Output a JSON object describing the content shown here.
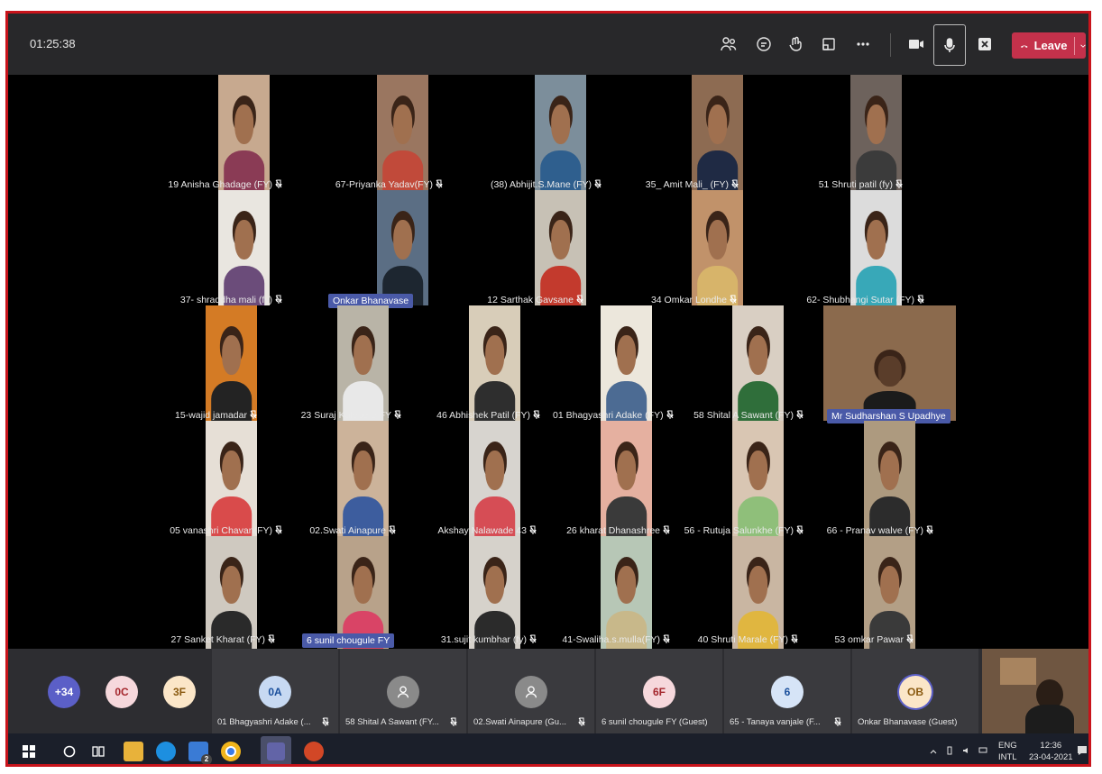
{
  "meeting": {
    "timer": "01:25:38",
    "leave_label": "Leave",
    "accent": "#c4314b",
    "frame_color": "#c8141b"
  },
  "toolbar_icons": [
    "people-icon",
    "chat-icon",
    "reactions-icon",
    "share-tray-icon",
    "more-options-icon",
    "camera-icon",
    "microphone-icon",
    "share-screen-icon"
  ],
  "grid": {
    "row1": [
      {
        "name": "19 Anisha Ghadage (FY)",
        "bg": "#c7a98f"
      },
      {
        "name": "67-Priyanka Yadav(FY)",
        "bg": "#9a7660"
      },
      {
        "name": "(38) Abhijit.S.Mane (FY)",
        "bg": "#7c8e9b"
      },
      {
        "name": "35_ Amit  Mali_ (FY)",
        "bg": "#8d6b52"
      },
      {
        "name": "51 Shruti patil (fy)",
        "bg": "#6d625c"
      }
    ],
    "row2": [
      {
        "name": "37- shraddha mali (fy)",
        "bg": "#e9e6e0"
      },
      {
        "name": "Onkar Bhanavase",
        "bg": "#5b6e84"
      },
      {
        "name": "12 Sarthak Gavsane",
        "bg": "#c7c1b5"
      },
      {
        "name": "34 Omkar Londhe",
        "bg": "#c1926a"
      },
      {
        "name": "62- Shubhangi Sutar (FY)",
        "bg": "#dcdcdc"
      }
    ],
    "row3": [
      {
        "name": "15-wajid jamadar",
        "bg": "#d47b25"
      },
      {
        "name": "23 Suraj Kalebere FY",
        "bg": "#b9b4a7"
      },
      {
        "name": "46 Abhishek Patil (FY)",
        "bg": "#d8cdb9"
      },
      {
        "name": "01 Bhagyashri Adake (FY)",
        "bg": "#ece7dc"
      },
      {
        "name": "58 Shital A Sawant (FY)",
        "bg": "#d9cfc3"
      },
      {
        "name": "Mr Sudharshan  S Upadhye",
        "bg": "#8b6a4d"
      }
    ],
    "row4": [
      {
        "name": "05 vanashri Chavan(FY)",
        "bg": "#e6dfd6"
      },
      {
        "name": "02.Swati Ainapure",
        "bg": "#ccb39a"
      },
      {
        "name": "Akshay Nalawade 43",
        "bg": "#d7d4cf"
      },
      {
        "name": "26 kharat Dhanashree",
        "bg": "#e5b0a0"
      },
      {
        "name": "56 - Rutuja Salunkhe (FY)",
        "bg": "#d9c6b3"
      },
      {
        "name": "66 - Pranav walve (FY)",
        "bg": "#ad9a7f"
      }
    ],
    "row5": [
      {
        "name": "27 Sanket Kharat (FY)",
        "bg": "#cfc9c0"
      },
      {
        "name": "6 sunil chougule FY",
        "bg": "#b8a28a"
      },
      {
        "name": "31.sujit kumbhar (fy)",
        "bg": "#d6d2cb"
      },
      {
        "name": "41-Swaliha.s.mulla(FY)",
        "bg": "#b7c7b6"
      },
      {
        "name": "40 Shruti Marale (FY)",
        "bg": "#c9b6a2"
      },
      {
        "name": "53 omkar Pawar",
        "bg": "#b39f86"
      }
    ]
  },
  "strip": {
    "overflow": [
      {
        "initials": "+34",
        "bg": "#5b5fc7",
        "fg": "#ffffff"
      },
      {
        "initials": "0C",
        "bg": "#f6d8dc",
        "fg": "#a4262c"
      },
      {
        "initials": "3F",
        "bg": "#fbe6c8",
        "fg": "#8a5a10"
      }
    ],
    "cells": [
      {
        "initials": "0A",
        "name": "01 Bhagyashri Adake (...",
        "bg": "#c7d9f2",
        "fg": "#1a4f9c",
        "muted": true
      },
      {
        "initials": "",
        "name": "58 Shital A Sawant (FY...",
        "bg": "#8a8a8a",
        "fg": "#ffffff",
        "muted": true
      },
      {
        "initials": "",
        "name": "02.Swati Ainapure (Gu...",
        "bg": "#8a8a8a",
        "fg": "#ffffff",
        "muted": true
      },
      {
        "initials": "6F",
        "name": "6 sunil chougule FY (Guest)",
        "bg": "#f6d8dc",
        "fg": "#a4262c",
        "muted": false
      },
      {
        "initials": "6",
        "name": "65 - Tanaya vanjale (F...",
        "bg": "#d6e4f7",
        "fg": "#1a4f9c",
        "muted": true
      },
      {
        "initials": "OB",
        "name": "Onkar Bhanavase (Guest)",
        "bg": "#fbe6c8",
        "fg": "#8a5a10",
        "muted": false
      }
    ]
  },
  "taskbar": {
    "lang_line1": "ENG",
    "lang_line2": "INTL",
    "time": "12:36",
    "date": "23-04-2021",
    "badge": "2"
  }
}
